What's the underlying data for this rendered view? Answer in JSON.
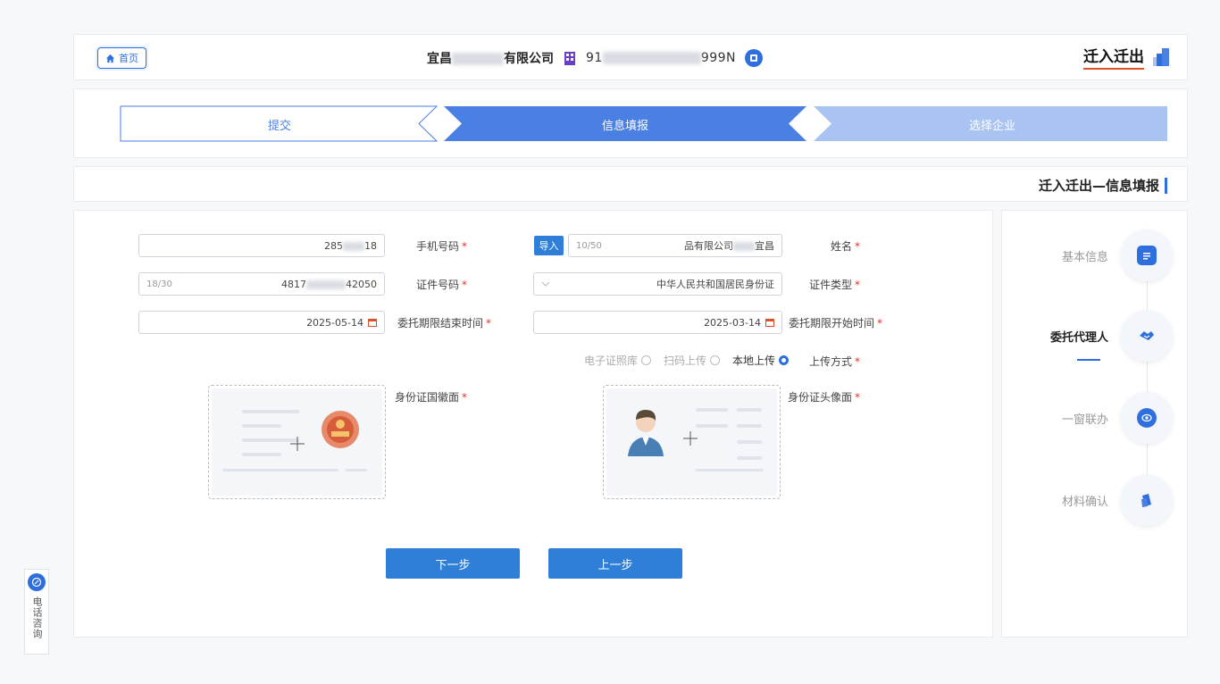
{
  "header": {
    "home_label": "首页",
    "company_name_prefix": "宜昌",
    "company_name_suffix": "有限公司",
    "credit_code_prefix": "91",
    "credit_code_suffix": "999N",
    "brand_title": "迁入迁出"
  },
  "steps": [
    {
      "label": "选择企业",
      "state": "done"
    },
    {
      "label": "信息填报",
      "state": "active"
    },
    {
      "label": "提交",
      "state": "todo"
    }
  ],
  "section_title": "迁入迁出—信息填报",
  "form": {
    "name": {
      "label": "姓名",
      "value": "宜昌",
      "value_suffix": "品有限公司",
      "counter": "10/50",
      "import_label": "导入"
    },
    "phone": {
      "label": "手机号码",
      "value_prefix": "18",
      "value_suffix": "285"
    },
    "cert_type": {
      "label": "证件类型",
      "value": "中华人民共和国居民身份证"
    },
    "cert_no": {
      "label": "证件号码",
      "value_prefix": "42050",
      "value_suffix": "4817",
      "counter": "18/30"
    },
    "start_date": {
      "label": "委托期限开始时间",
      "value": "2025-03-14"
    },
    "end_date": {
      "label": "委托期限结束时间",
      "value": "2025-05-14"
    },
    "upload_method": {
      "label": "上传方式",
      "options": [
        "本地上传",
        "扫码上传",
        "电子证照库"
      ],
      "selected": "本地上传"
    },
    "id_front": {
      "label": "身份证头像面"
    },
    "id_back": {
      "label": "身份证国徽面"
    },
    "prev_label": "上一步",
    "next_label": "下一步"
  },
  "sidenav": [
    {
      "label": "基本信息",
      "icon": "document-icon",
      "active": false
    },
    {
      "label": "委托代理人",
      "icon": "handshake-icon",
      "active": true
    },
    {
      "label": "一窗联办",
      "icon": "eye-icon",
      "active": false
    },
    {
      "label": "材料确认",
      "icon": "file-icon",
      "active": false
    }
  ],
  "consult_label": "电话咨询",
  "colors": {
    "primary": "#2f6fdd",
    "step_done": "#a9c3f2",
    "step_active": "#4a7fe3"
  }
}
